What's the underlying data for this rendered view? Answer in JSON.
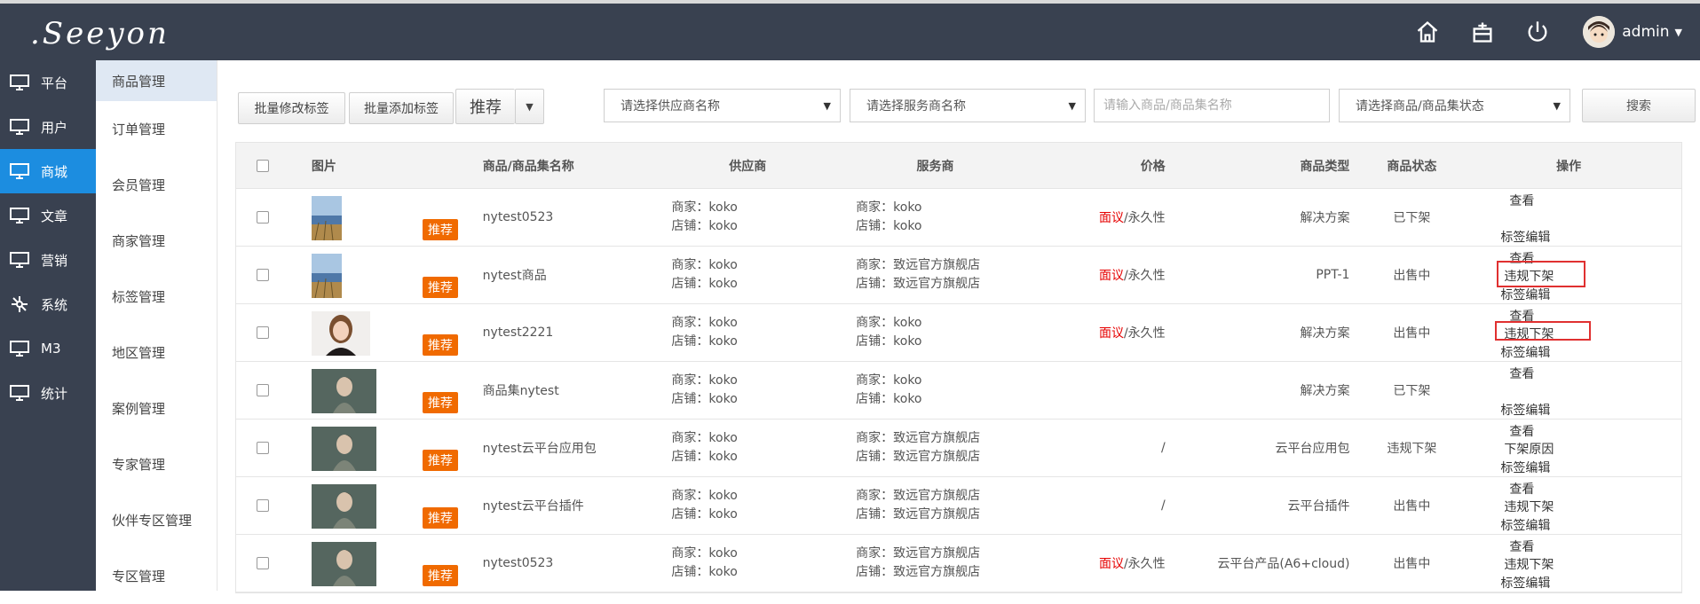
{
  "header": {
    "logo_text": ".Seeyon",
    "icons": [
      "home-icon",
      "store-icon",
      "power-icon"
    ],
    "user": "admin"
  },
  "leftnav": [
    {
      "label": "平台",
      "icon": "monitor-icon",
      "active": false
    },
    {
      "label": "用户",
      "icon": "monitor-icon",
      "active": false
    },
    {
      "label": "商城",
      "icon": "monitor-icon",
      "active": true
    },
    {
      "label": "文章",
      "icon": "monitor-icon",
      "active": false
    },
    {
      "label": "营销",
      "icon": "monitor-icon",
      "active": false
    },
    {
      "label": "系统",
      "icon": "network-icon",
      "active": false
    },
    {
      "label": "M3",
      "icon": "monitor-icon",
      "active": false
    },
    {
      "label": "统计",
      "icon": "monitor-icon",
      "active": false
    }
  ],
  "submenu": [
    "商品管理",
    "订单管理",
    "会员管理",
    "商家管理",
    "标签管理",
    "地区管理",
    "案例管理",
    "专家管理",
    "伙伴专区管理",
    "专区管理"
  ],
  "toolbar": {
    "batch_edit_tag": "批量修改标签",
    "batch_add_tag": "批量添加标签",
    "recommend": "推荐",
    "supplier_select": "请选择供应商名称",
    "service_select": "请选择服务商名称",
    "keyword_placeholder": "请输入商品/商品集名称",
    "status_select": "请选择商品/商品集状态",
    "search": "搜索"
  },
  "table": {
    "headers": {
      "image": "图片",
      "name": "商品/商品集名称",
      "supplier": "供应商",
      "service": "服务商",
      "price": "价格",
      "type": "商品类型",
      "status": "商品状态",
      "ops": "操作"
    },
    "rows": [
      {
        "thumb": "landscape",
        "badge": "推荐",
        "name": "nytest0523",
        "sup1": "商家：koko",
        "sup2": "店铺：koko",
        "svc1": "商家：koko",
        "svc2": "店铺：koko",
        "price_red": "面议",
        "price_rest": "/永久性",
        "type": "解决方案",
        "status": "已下架",
        "op_top": "查看",
        "op_mid": "",
        "op_bot": "标签编辑",
        "boxed": false
      },
      {
        "thumb": "landscape",
        "badge": "推荐",
        "name": "nytest商品",
        "sup1": "商家：koko",
        "sup2": "店铺：koko",
        "svc1": "商家：致远官方旗舰店",
        "svc2": "店铺：致远官方旗舰店",
        "price_red": "面议",
        "price_rest": "/永久性",
        "type": "PPT-1",
        "status": "出售中",
        "op_top": "查看",
        "op_mid": "违规下架",
        "op_bot": "标签编辑",
        "boxed": true
      },
      {
        "thumb": "portrait",
        "badge": "推荐",
        "name": "nytest2221",
        "sup1": "商家：koko",
        "sup2": "店铺：koko",
        "svc1": "商家：koko",
        "svc2": "店铺：koko",
        "price_red": "面议",
        "price_rest": "/永久性",
        "type": "解决方案",
        "status": "出售中",
        "op_top": "查看",
        "op_mid": "违规下架",
        "op_bot": "标签编辑",
        "boxed": true
      },
      {
        "thumb": "child",
        "badge": "推荐",
        "name": "商品集nytest",
        "sup1": "商家：koko",
        "sup2": "店铺：koko",
        "svc1": "商家：koko",
        "svc2": "店铺：koko",
        "price_red": "",
        "price_rest": "",
        "type": "解决方案",
        "status": "已下架",
        "op_top": "查看",
        "op_mid": "",
        "op_bot": "标签编辑",
        "boxed": false
      },
      {
        "thumb": "child",
        "badge": "推荐",
        "name": "nytest云平台应用包",
        "sup1": "商家：koko",
        "sup2": "店铺：koko",
        "svc1": "商家：致远官方旗舰店",
        "svc2": "店铺：致远官方旗舰店",
        "price_red": "",
        "price_rest": "/",
        "type": "云平台应用包",
        "status": "违规下架",
        "op_top": "查看",
        "op_mid": "下架原因",
        "op_bot": "标签编辑",
        "boxed": false
      },
      {
        "thumb": "child",
        "badge": "推荐",
        "name": "nytest云平台插件",
        "sup1": "商家：koko",
        "sup2": "店铺：koko",
        "svc1": "商家：致远官方旗舰店",
        "svc2": "店铺：致远官方旗舰店",
        "price_red": "",
        "price_rest": "/",
        "type": "云平台插件",
        "status": "出售中",
        "op_top": "查看",
        "op_mid": "违规下架",
        "op_bot": "标签编辑",
        "boxed": false
      },
      {
        "thumb": "child",
        "badge": "推荐",
        "name": "nytest0523",
        "sup1": "商家：koko",
        "sup2": "店铺：koko",
        "svc1": "商家：致远官方旗舰店",
        "svc2": "店铺：致远官方旗舰店",
        "price_red": "面议",
        "price_rest": "/永久性",
        "type": "云平台产品(A6+cloud)",
        "status": "出售中",
        "op_top": "查看",
        "op_mid": "违规下架",
        "op_bot": "标签编辑",
        "boxed": false
      }
    ]
  },
  "colors": {
    "header_bg": "#394150",
    "active_nav": "#1c8de0",
    "badge": "#f06a00",
    "price_red": "#e60000",
    "highlight_box": "#e03030"
  }
}
